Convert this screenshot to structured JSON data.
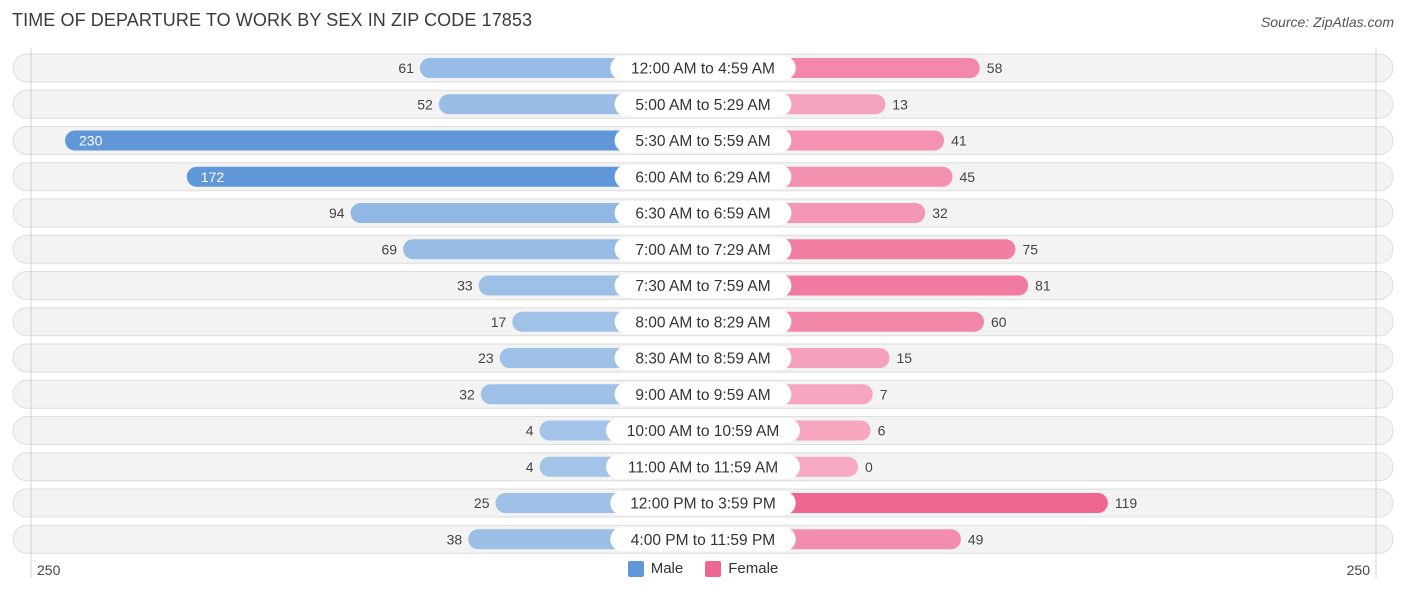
{
  "header": {
    "title": "TIME OF DEPARTURE TO WORK BY SEX IN ZIP CODE 17853",
    "source": "Source: ZipAtlas.com"
  },
  "colors": {
    "male_strong": "#5f97d9",
    "male_light": "#a4c4e8",
    "female_strong": "#ef6690",
    "female_light": "#f6a9c2",
    "row_bg": "#f3f3f3",
    "row_border": "#dedede"
  },
  "legend": {
    "male_label": "Male",
    "female_label": "Female"
  },
  "axis": {
    "left_label": "250",
    "right_label": "250"
  },
  "chart_data": {
    "type": "bar",
    "orientation": "horizontal-diverging",
    "title": "TIME OF DEPARTURE TO WORK BY SEX IN ZIP CODE 17853",
    "xlabel": "",
    "ylabel": "",
    "xlim": [
      -250,
      250
    ],
    "legend_position": "bottom-center",
    "categories": [
      "12:00 AM to 4:59 AM",
      "5:00 AM to 5:29 AM",
      "5:30 AM to 5:59 AM",
      "6:00 AM to 6:29 AM",
      "6:30 AM to 6:59 AM",
      "7:00 AM to 7:29 AM",
      "7:30 AM to 7:59 AM",
      "8:00 AM to 8:29 AM",
      "8:30 AM to 8:59 AM",
      "9:00 AM to 9:59 AM",
      "10:00 AM to 10:59 AM",
      "11:00 AM to 11:59 AM",
      "12:00 PM to 3:59 PM",
      "4:00 PM to 11:59 PM"
    ],
    "series": [
      {
        "name": "Male",
        "side": "left",
        "values": [
          61,
          52,
          230,
          172,
          94,
          69,
          33,
          17,
          23,
          32,
          4,
          4,
          25,
          38
        ]
      },
      {
        "name": "Female",
        "side": "right",
        "values": [
          58,
          13,
          41,
          45,
          32,
          75,
          81,
          60,
          15,
          7,
          6,
          0,
          119,
          49
        ]
      }
    ]
  }
}
